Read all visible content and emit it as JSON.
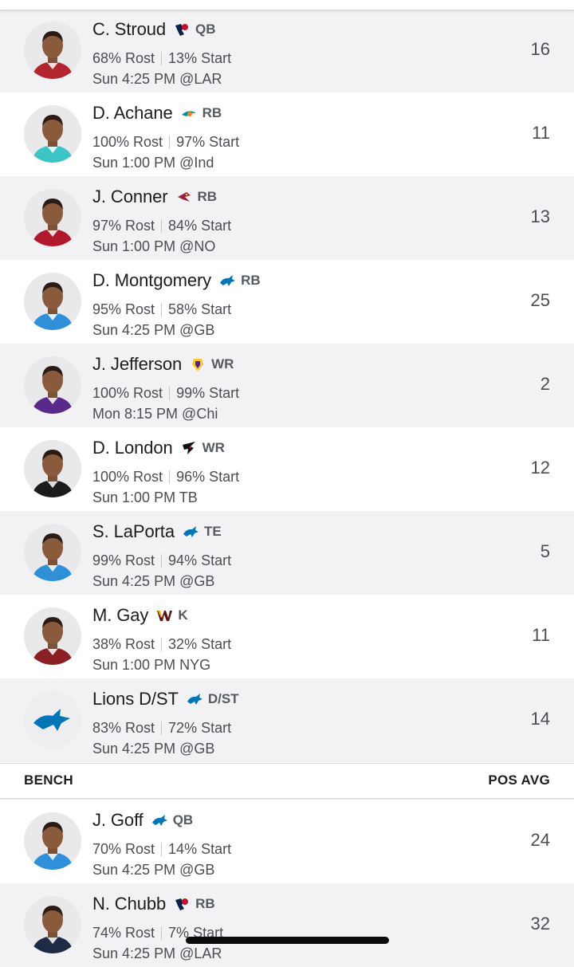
{
  "starters": [
    {
      "name": "C. Stroud",
      "team_icon": "texans-logo-icon",
      "position": "QB",
      "rost": "68% Rost",
      "start": "13% Start",
      "game": "Sun 4:25 PM @LAR",
      "rank": "16",
      "jersey_color": "#b3262f",
      "team_color": "#c8102e"
    },
    {
      "name": "D. Achane",
      "team_icon": "dolphins-logo-icon",
      "position": "RB",
      "rost": "100% Rost",
      "start": "97% Start",
      "game": "Sun 1:00 PM @Ind",
      "rank": "11",
      "jersey_color": "#3cc4c6",
      "team_color": "#008e97"
    },
    {
      "name": "J. Conner",
      "team_icon": "cardinals-logo-icon",
      "position": "RB",
      "rost": "97% Rost",
      "start": "84% Start",
      "game": "Sun 1:00 PM @NO",
      "rank": "13",
      "jersey_color": "#b0182c",
      "team_color": "#97233f"
    },
    {
      "name": "D. Montgomery",
      "team_icon": "lions-logo-icon",
      "position": "RB",
      "rost": "95% Rost",
      "start": "58% Start",
      "game": "Sun 4:25 PM @GB",
      "rank": "25",
      "jersey_color": "#2f8fd8",
      "team_color": "#0076b6"
    },
    {
      "name": "J. Jefferson",
      "team_icon": "vikings-logo-icon",
      "position": "WR",
      "rost": "100% Rost",
      "start": "99% Start",
      "game": "Mon 8:15 PM @Chi",
      "rank": "2",
      "jersey_color": "#5a2a8a",
      "team_color": "#4f2683"
    },
    {
      "name": "D. London",
      "team_icon": "falcons-logo-icon",
      "position": "WR",
      "rost": "100% Rost",
      "start": "96% Start",
      "game": "Sun 1:00 PM TB",
      "rank": "12",
      "jersey_color": "#1c1c1e",
      "team_color": "#a71930"
    },
    {
      "name": "S. LaPorta",
      "team_icon": "lions-logo-icon",
      "position": "TE",
      "rost": "99% Rost",
      "start": "94% Start",
      "game": "Sun 4:25 PM @GB",
      "rank": "5",
      "jersey_color": "#2f8fd8",
      "team_color": "#0076b6"
    },
    {
      "name": "M. Gay",
      "team_icon": "commanders-logo-icon",
      "position": "K",
      "rost": "38% Rost",
      "start": "32% Start",
      "game": "Sun 1:00 PM NYG",
      "rank": "11",
      "jersey_color": "#8a1f24",
      "team_color": "#5a1414"
    },
    {
      "name": "Lions D/ST",
      "team_icon": "lions-logo-icon",
      "position": "D/ST",
      "rost": "83% Rost",
      "start": "72% Start",
      "game": "Sun 4:25 PM @GB",
      "rank": "14",
      "jersey_color": "#2f8fd8",
      "team_color": "#0076b6"
    }
  ],
  "bench_header": {
    "label": "BENCH",
    "pos_avg_label": "POS AVG"
  },
  "bench": [
    {
      "name": "J. Goff",
      "team_icon": "lions-logo-icon",
      "position": "QB",
      "rost": "70% Rost",
      "start": "14% Start",
      "game": "Sun 4:25 PM @GB",
      "rank": "24",
      "jersey_color": "#2f8fd8",
      "team_color": "#0076b6"
    },
    {
      "name": "N. Chubb",
      "team_icon": "texans-logo-icon",
      "position": "RB",
      "rost": "74% Rost",
      "start": "7% Start",
      "game": "Sun 4:25 PM @LAR",
      "rank": "32",
      "jersey_color": "#1f2a44",
      "team_color": "#c8102e"
    }
  ]
}
